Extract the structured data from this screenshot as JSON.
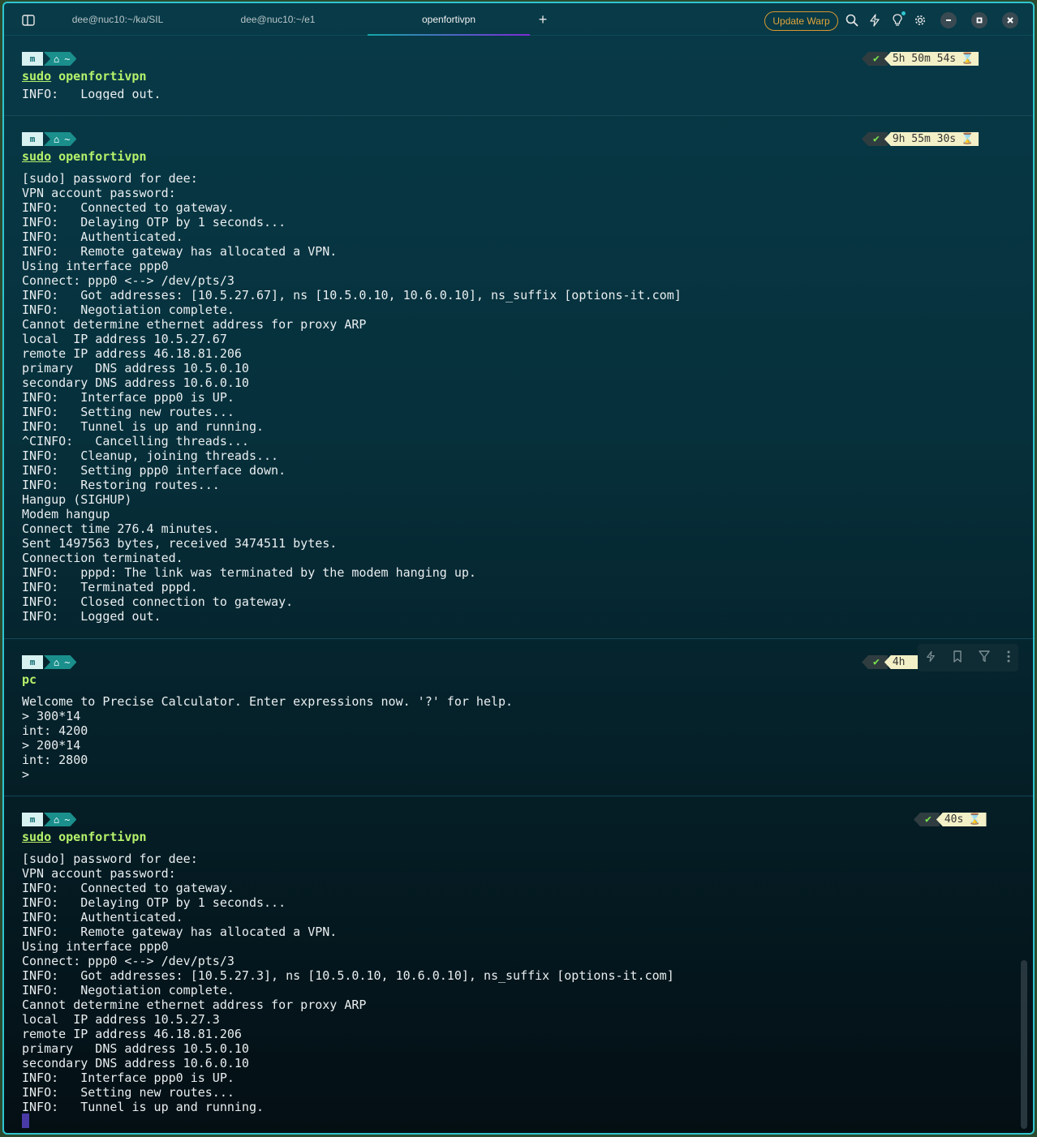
{
  "titlebar": {
    "tabs": [
      {
        "label": "dee@nuc10:~/ka/SIL"
      },
      {
        "label": "dee@nuc10:~/e1"
      },
      {
        "label": "openfortivpn"
      }
    ],
    "new_tab": "+",
    "update_label": "Update Warp"
  },
  "prompt": {
    "home": "~",
    "check": "✔"
  },
  "blocks": [
    {
      "cmd_prefix": "sudo",
      "cmd": "openfortivpn",
      "duration": "5h 50m 54s",
      "output": "INFO:   Logged out."
    },
    {
      "cmd_prefix": "sudo",
      "cmd": "openfortivpn",
      "duration": "9h 55m 30s",
      "output": "[sudo] password for dee:\nVPN account password:\nINFO:   Connected to gateway.\nINFO:   Delaying OTP by 1 seconds...\nINFO:   Authenticated.\nINFO:   Remote gateway has allocated a VPN.\nUsing interface ppp0\nConnect: ppp0 <--> /dev/pts/3\nINFO:   Got addresses: [10.5.27.67], ns [10.5.0.10, 10.6.0.10], ns_suffix [options-it.com]\nINFO:   Negotiation complete.\nCannot determine ethernet address for proxy ARP\nlocal  IP address 10.5.27.67\nremote IP address 46.18.81.206\nprimary   DNS address 10.5.0.10\nsecondary DNS address 10.6.0.10\nINFO:   Interface ppp0 is UP.\nINFO:   Setting new routes...\nINFO:   Tunnel is up and running.\n^CINFO:   Cancelling threads...\nINFO:   Cleanup, joining threads...\nINFO:   Setting ppp0 interface down.\nINFO:   Restoring routes...\nHangup (SIGHUP)\nModem hangup\nConnect time 276.4 minutes.\nSent 1497563 bytes, received 3474511 bytes.\nConnection terminated.\nINFO:   pppd: The link was terminated by the modem hanging up.\nINFO:   Terminated pppd.\nINFO:   Closed connection to gateway.\nINFO:   Logged out."
    },
    {
      "cmd_prefix": "",
      "cmd": "pc",
      "duration": "4h",
      "output": "Welcome to Precise Calculator. Enter expressions now. '?' for help.\n> 300*14\nint: 4200\n> 200*14\nint: 2800\n>"
    },
    {
      "cmd_prefix": "sudo",
      "cmd": "openfortivpn",
      "duration": "40s",
      "output": "[sudo] password for dee:\nVPN account password:\nINFO:   Connected to gateway.\nINFO:   Delaying OTP by 1 seconds...\nINFO:   Authenticated.\nINFO:   Remote gateway has allocated a VPN.\nUsing interface ppp0\nConnect: ppp0 <--> /dev/pts/3\nINFO:   Got addresses: [10.5.27.3], ns [10.5.0.10, 10.6.0.10], ns_suffix [options-it.com]\nINFO:   Negotiation complete.\nCannot determine ethernet address for proxy ARP\nlocal  IP address 10.5.27.3\nremote IP address 46.18.81.206\nprimary   DNS address 10.5.0.10\nsecondary DNS address 10.6.0.10\nINFO:   Interface ppp0 is UP.\nINFO:   Setting new routes...\nINFO:   Tunnel is up and running."
    }
  ],
  "colors": {
    "accent": "#2fc6cf",
    "command": "#b5f26b",
    "update_button": "#d79a2f"
  }
}
